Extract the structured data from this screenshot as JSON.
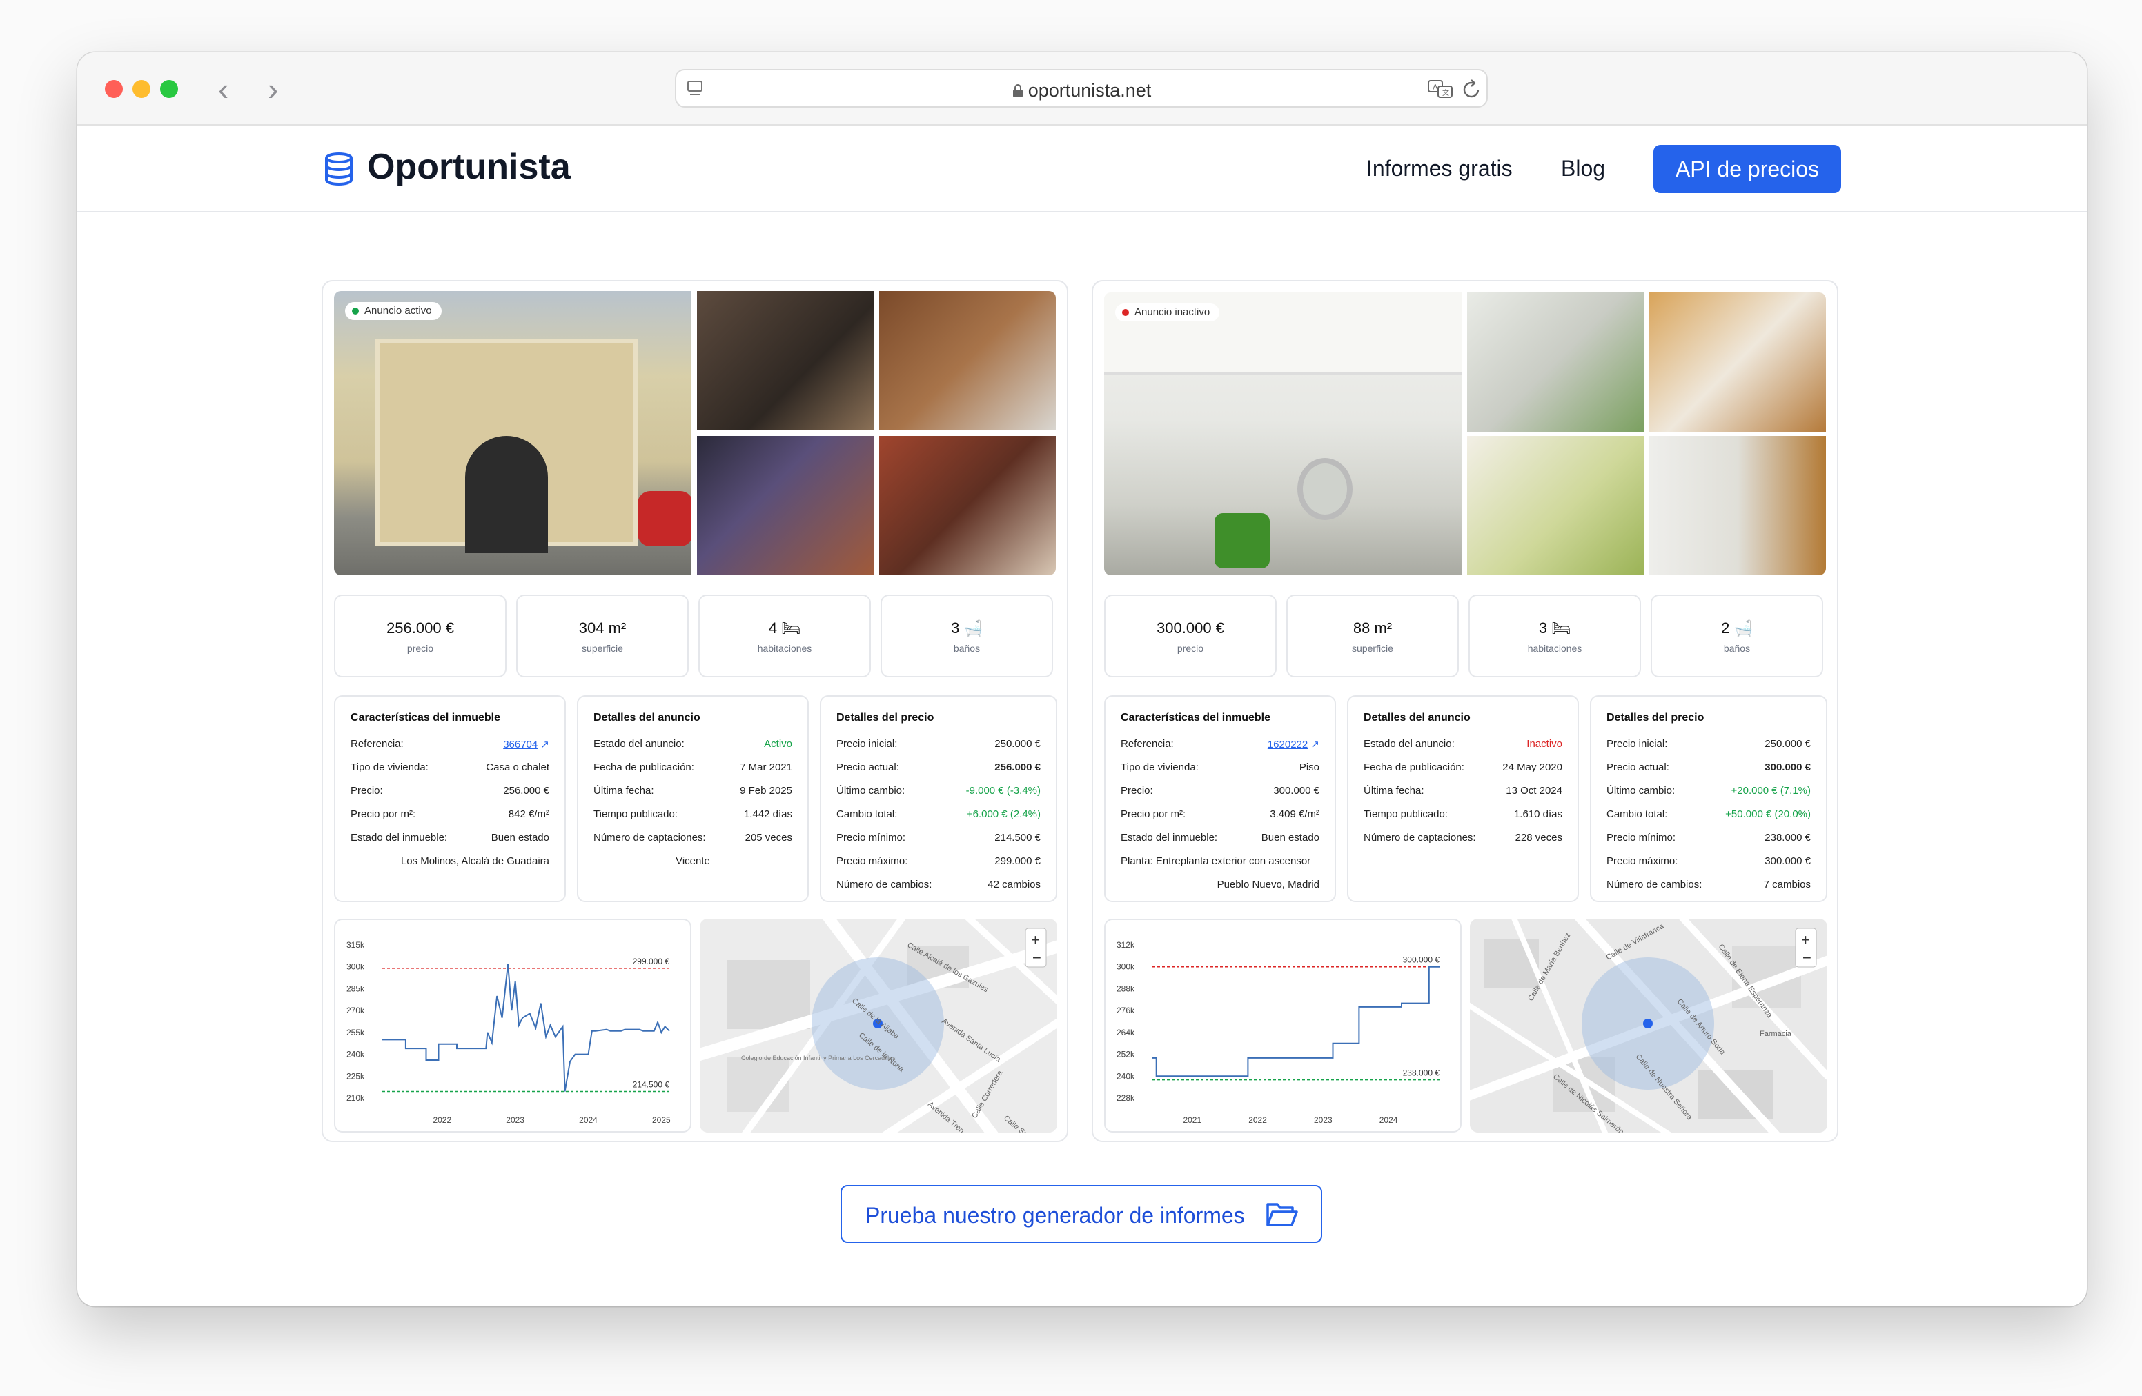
{
  "browser": {
    "url": "oportunista.net"
  },
  "site": {
    "logo": "Oportunista",
    "nav": [
      "Informes gratis",
      "Blog"
    ],
    "api_button": "API de precios"
  },
  "listings": [
    {
      "badge": "Anuncio activo",
      "stats": [
        {
          "value": "256.000 €",
          "label": "precio"
        },
        {
          "value": "304 m²",
          "label": "superficie"
        },
        {
          "value": "4",
          "label": "habitaciones"
        },
        {
          "value": "3",
          "label": "baños"
        }
      ],
      "features": {
        "title": "Características del inmueble",
        "rows": [
          {
            "k": "Referencia:",
            "v": "366704"
          },
          {
            "k": "Tipo de vivienda:",
            "v": "Casa o chalet"
          },
          {
            "k": "Precio:",
            "v": "256.000 €"
          },
          {
            "k": "Precio por m²:",
            "v": "842 €/m²"
          },
          {
            "k": "Estado del inmueble:",
            "v": "Buen estado"
          }
        ],
        "location": "Los Molinos, Alcalá de Guadaira"
      },
      "details": {
        "title": "Detalles del anuncio",
        "rows": [
          {
            "k": "Estado del anuncio:",
            "v": "Activo"
          },
          {
            "k": "Fecha de publicación:",
            "v": "7 Mar 2021"
          },
          {
            "k": "Última fecha:",
            "v": "9 Feb 2025"
          },
          {
            "k": "Tiempo publicado:",
            "v": "1.442 días"
          },
          {
            "k": "Número de captaciones:",
            "v": "205 veces"
          }
        ],
        "agent": "Vicente"
      },
      "price": {
        "title": "Detalles del precio",
        "rows": [
          {
            "k": "Precio inicial:",
            "v": "250.000 €"
          },
          {
            "k": "Precio actual:",
            "v": "256.000 €"
          },
          {
            "k": "Último cambio:",
            "v": "-9.000 € (-3.4%)"
          },
          {
            "k": "Cambio total:",
            "v": "+6.000 € (2.4%)"
          },
          {
            "k": "Precio mínimo:",
            "v": "214.500 €"
          },
          {
            "k": "Precio máximo:",
            "v": "299.000 €"
          },
          {
            "k": "Número de cambios:",
            "v": "42 cambios"
          }
        ]
      },
      "map_labels": [
        "Calle Alcalá de los Gazules",
        "Avenida Santa Lucía",
        "Calle Corredera",
        "Calle Sevilla",
        "Calle de la Aljaba",
        "Calle de la Noria",
        "Avenida Tren",
        "Colegio de Educación Infantil y Primaria Los Cercadillos"
      ]
    },
    {
      "badge": "Anuncio inactivo",
      "stats": [
        {
          "value": "300.000 €",
          "label": "precio"
        },
        {
          "value": "88 m²",
          "label": "superficie"
        },
        {
          "value": "3",
          "label": "habitaciones"
        },
        {
          "value": "2",
          "label": "baños"
        }
      ],
      "features": {
        "title": "Características del inmueble",
        "rows": [
          {
            "k": "Referencia:",
            "v": "1620222"
          },
          {
            "k": "Tipo de vivienda:",
            "v": "Piso"
          },
          {
            "k": "Precio:",
            "v": "300.000 €"
          },
          {
            "k": "Precio por m²:",
            "v": "3.409 €/m²"
          },
          {
            "k": "Estado del inmueble:",
            "v": "Buen estado"
          }
        ],
        "floor": "Planta:  Entreplanta exterior con ascensor",
        "location": "Pueblo Nuevo, Madrid"
      },
      "details": {
        "title": "Detalles del anuncio",
        "rows": [
          {
            "k": "Estado del anuncio:",
            "v": "Inactivo"
          },
          {
            "k": "Fecha de publicación:",
            "v": "24 May 2020"
          },
          {
            "k": "Última fecha:",
            "v": "13 Oct 2024"
          },
          {
            "k": "Tiempo publicado:",
            "v": "1.610 días"
          },
          {
            "k": "Número de captaciones:",
            "v": "228 veces"
          }
        ]
      },
      "price": {
        "title": "Detalles del precio",
        "rows": [
          {
            "k": "Precio inicial:",
            "v": "250.000 €"
          },
          {
            "k": "Precio actual:",
            "v": "300.000 €"
          },
          {
            "k": "Último cambio:",
            "v": "+20.000 € (7.1%)"
          },
          {
            "k": "Cambio total:",
            "v": "+50.000 € (20.0%)"
          },
          {
            "k": "Precio mínimo:",
            "v": "238.000 €"
          },
          {
            "k": "Precio máximo:",
            "v": "300.000 €"
          },
          {
            "k": "Número de cambios:",
            "v": "7 cambios"
          }
        ]
      },
      "map_labels": [
        "Calle de Villafranca",
        "Calle de María Benítez",
        "Calle de Nicolás Salmerón",
        "Calle de Nuestra Señora",
        "Calle de Arturo Soria",
        "Calle de Elena Esperanza",
        "Farmacia"
      ]
    }
  ],
  "chart_data": [
    {
      "type": "line",
      "yticks": [
        "315k",
        "300k",
        "285k",
        "270k",
        "255k",
        "240k",
        "225k",
        "210k"
      ],
      "ylim": [
        210000,
        315000
      ],
      "xticks": [
        "2022",
        "2023",
        "2024",
        "2025"
      ],
      "xtick_pos": [
        2022,
        2023,
        2024,
        2025
      ],
      "xlim": [
        2021.18,
        2025.11
      ],
      "max_line": {
        "value": 299000,
        "label": "299.000 €"
      },
      "min_line": {
        "value": 214500,
        "label": "214.500 €"
      },
      "x": [
        2021.18,
        2021.5,
        2021.5,
        2021.78,
        2021.78,
        2021.95,
        2021.95,
        2022.2,
        2022.2,
        2022.6,
        2022.62,
        2022.68,
        2022.75,
        2022.82,
        2022.9,
        2022.95,
        2023.0,
        2023.05,
        2023.1,
        2023.2,
        2023.28,
        2023.35,
        2023.42,
        2023.48,
        2023.55,
        2023.65,
        2023.68,
        2023.75,
        2023.82,
        2023.92,
        2024.0,
        2024.05,
        2024.1,
        2024.25,
        2024.3,
        2024.45,
        2024.5,
        2024.7,
        2024.75,
        2024.9,
        2024.95,
        2025.0,
        2025.05,
        2025.11
      ],
      "values": [
        250000,
        250000,
        244000,
        244000,
        236000,
        236000,
        247000,
        247000,
        244000,
        244000,
        255000,
        248000,
        280000,
        265000,
        302000,
        270000,
        290000,
        260000,
        265000,
        268000,
        258000,
        275000,
        252000,
        260000,
        252000,
        259000,
        214500,
        235000,
        240000,
        240000,
        240000,
        256000,
        256000,
        257000,
        256000,
        256000,
        257000,
        257000,
        256000,
        256000,
        262000,
        255000,
        259000,
        256000
      ]
    },
    {
      "type": "line",
      "yticks": [
        "312k",
        "300k",
        "288k",
        "276k",
        "264k",
        "252k",
        "240k",
        "228k"
      ],
      "ylim": [
        228000,
        312000
      ],
      "xticks": [
        "2021",
        "2022",
        "2023",
        "2024"
      ],
      "xtick_pos": [
        2021,
        2022,
        2023,
        2024
      ],
      "xlim": [
        2020.39,
        2024.78
      ],
      "max_line": {
        "value": 300000,
        "label": "300.000 €"
      },
      "min_line": {
        "value": 238000,
        "label": "238.000 €"
      },
      "x": [
        2020.39,
        2020.45,
        2020.45,
        2021.85,
        2021.85,
        2023.15,
        2023.15,
        2023.55,
        2023.55,
        2024.2,
        2024.2,
        2024.62,
        2024.62,
        2024.78
      ],
      "values": [
        250000,
        250000,
        240000,
        240000,
        250000,
        250000,
        258000,
        258000,
        278000,
        278000,
        280000,
        280000,
        300000,
        300000
      ]
    }
  ],
  "cta": {
    "label": "Prueba nuestro generador de informes"
  }
}
